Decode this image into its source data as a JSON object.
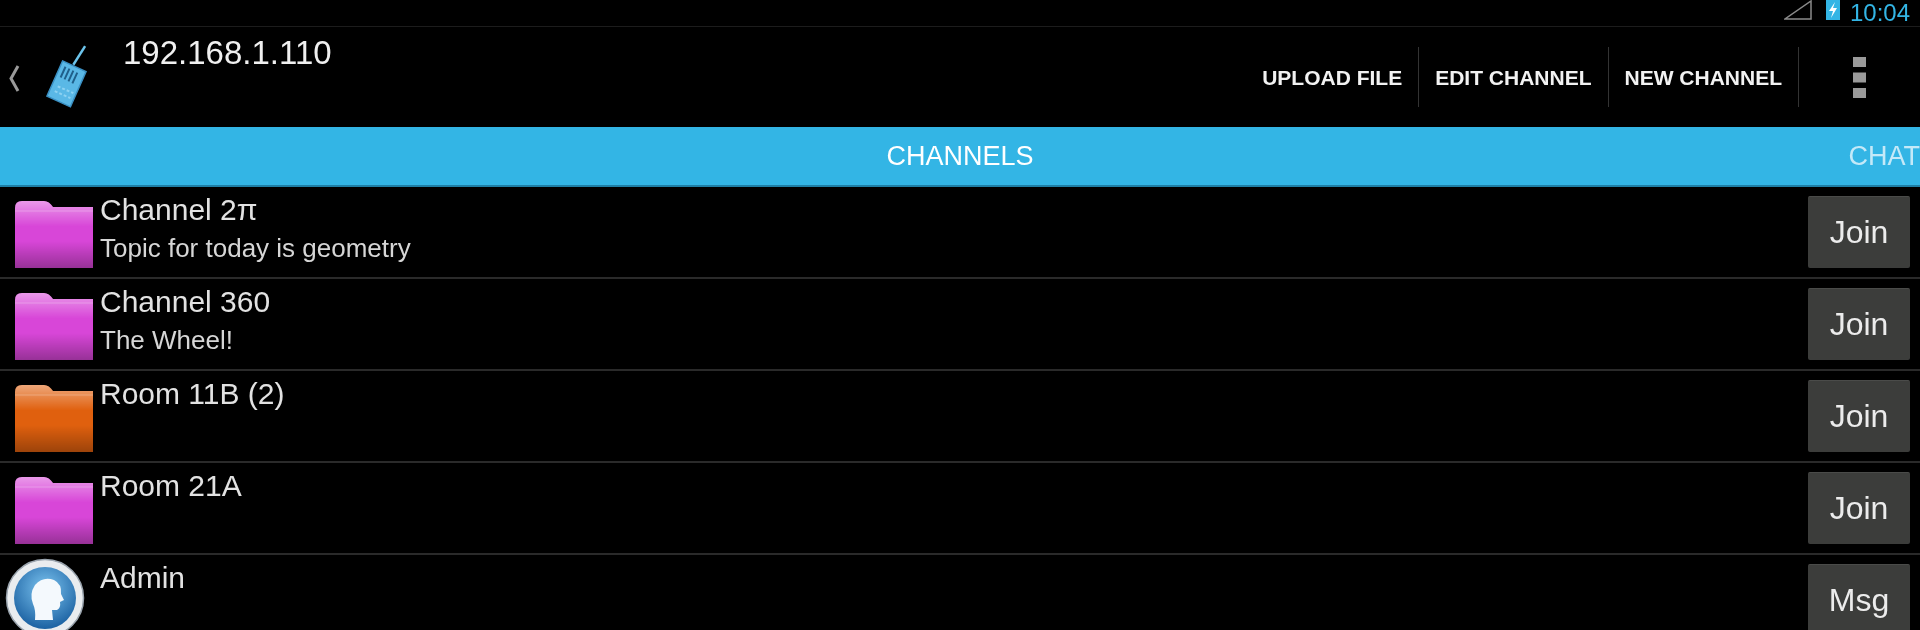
{
  "status_bar": {
    "time": "10:04"
  },
  "action_bar": {
    "title": "192.168.1.110",
    "actions": [
      "UPLOAD FILE",
      "EDIT CHANNEL",
      "NEW CHANNEL"
    ]
  },
  "tabs": [
    {
      "label": "CHANNELS",
      "selected": true
    },
    {
      "label": "CHAT",
      "selected": false
    }
  ],
  "rows": [
    {
      "kind": "channel",
      "title": "Channel 2π",
      "subtitle": "Topic for today is geometry",
      "color": "#d846d8",
      "button": "Join"
    },
    {
      "kind": "channel",
      "title": "Channel 360",
      "subtitle": "The Wheel!",
      "color": "#d846d8",
      "button": "Join"
    },
    {
      "kind": "channel",
      "title": "Room 11B (2)",
      "color": "#e0600e",
      "button": "Join"
    },
    {
      "kind": "channel",
      "title": "Room 21A",
      "color": "#d846d8",
      "button": "Join"
    },
    {
      "kind": "user",
      "title": "Admin",
      "button": "Msg"
    }
  ]
}
